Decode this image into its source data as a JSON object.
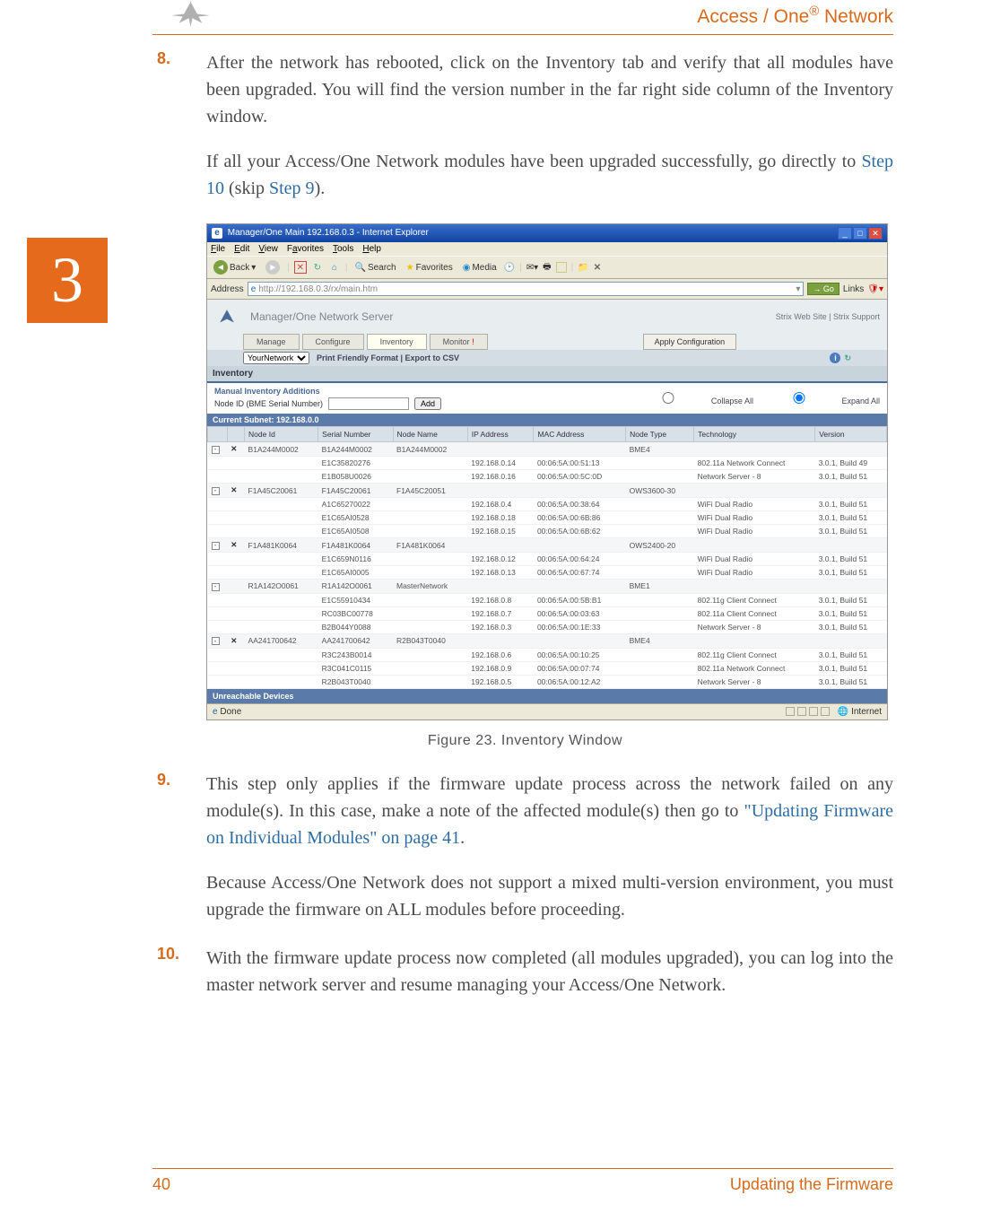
{
  "header": {
    "title_pre": "Access / One",
    "title_sup": "®",
    "title_post": " Network"
  },
  "chapter": "3",
  "steps": {
    "s8": {
      "num": "8.",
      "p1": "After the network has rebooted, click on the Inventory tab and verify that all modules have been upgraded. You will find the version number in the far right side column of the Inventory window.",
      "p2a": "If all your Access/One Network modules have been upgraded successfully, go directly to ",
      "p2link1": "Step 10",
      "p2b": " (skip ",
      "p2link2": "Step 9",
      "p2c": ")."
    },
    "caption": "Figure 23. Inventory Window",
    "s9": {
      "num": "9.",
      "p1a": "This step only applies if the firmware update process across the network failed on any module(s). In this case, make a note of the affected module(s) then go to ",
      "p1link": "\"Updating Firmware on Individual Modules\" on page 41",
      "p1b": ".",
      "p2": "Because Access/One Network does not support a mixed multi-version environment, you must upgrade the firmware on ALL modules before proceeding."
    },
    "s10": {
      "num": "10.",
      "p1": "With the firmware update process now completed (all modules upgraded), you can log into the master network server and resume managing your Access/One Network."
    }
  },
  "footer": {
    "page": "40",
    "section": "Updating the Firmware"
  },
  "screenshot": {
    "winTitle": "Manager/One Main 192.168.0.3 - Internet Explorer",
    "menus": {
      "file": "File",
      "edit": "Edit",
      "view": "View",
      "fav": "Favorites",
      "tools": "Tools",
      "help": "Help"
    },
    "toolbar": {
      "back": "Back",
      "search": "Search",
      "favorites": "Favorites",
      "media": "Media"
    },
    "addressLabel": "Address",
    "addressValue": "http://192.168.0.3/rx/main.htm",
    "go": "Go",
    "links": "Links",
    "serverTitle": "Manager/One Network Server",
    "strixLinks": "Strix Web Site  |  Strix Support",
    "tabs": {
      "manage": "Manage",
      "configure": "Configure",
      "inventory": "Inventory",
      "monitor": "Monitor"
    },
    "applyBtn": "Apply Configuration",
    "subbar": "Print Friendly Format |  Export to CSV",
    "invTitle": "Inventory",
    "addTitle": "Manual Inventory Additions",
    "addLabel": "Node ID (BME Serial Number)",
    "addBtn": "Add",
    "collapse": "Collapse All",
    "expand": "Expand All",
    "subnet": "Current Subnet: 192.168.0.0",
    "headers": [
      "",
      "",
      "Node Id",
      "Serial Number",
      "Node Name",
      "IP Address",
      "MAC Address",
      "Node Type",
      "Technology",
      "Version"
    ],
    "rows": [
      {
        "g": true,
        "exp": "-",
        "x": "✕",
        "nid": "B1A244M0002",
        "sn": "B1A244M0002",
        "nn": "B1A244M0002",
        "ip": "",
        "mac": "",
        "nt": "BME4",
        "tech": "",
        "ver": ""
      },
      {
        "nid": "",
        "sn": "E1C35820276",
        "nn": "",
        "ip": "192.168.0.14",
        "mac": "00:06:5A:00:51:13",
        "nt": "",
        "tech": "802.11a Network Connect",
        "ver": "3.0.1, Build 49"
      },
      {
        "nid": "",
        "sn": "E1B058U0026",
        "nn": "",
        "ip": "192.168.0.16",
        "mac": "00:06:5A:00:5C:0D",
        "nt": "",
        "tech": "Network Server - 8",
        "ver": "3.0.1, Build 51"
      },
      {
        "g": true,
        "exp": "-",
        "x": "✕",
        "nid": "F1A45C20061",
        "sn": "F1A45C20061",
        "nn": "F1A45C20051",
        "ip": "",
        "mac": "",
        "nt": "OWS3600-30",
        "tech": "",
        "ver": ""
      },
      {
        "nid": "",
        "sn": "A1C65270022",
        "nn": "",
        "ip": "192.168.0.4",
        "mac": "00:06:5A:00:38:64",
        "nt": "",
        "tech": "WiFi Dual Radio",
        "ver": "3.0.1, Build 51"
      },
      {
        "nid": "",
        "sn": "E1C65AI0528",
        "nn": "",
        "ip": "192.168.0.18",
        "mac": "00:06:5A:00:6B:86",
        "nt": "",
        "tech": "WiFi Dual Radio",
        "ver": "3.0.1, Build 51"
      },
      {
        "nid": "",
        "sn": "E1C65AI0508",
        "nn": "",
        "ip": "192.168.0.15",
        "mac": "00:06:5A:00:6B:62",
        "nt": "",
        "tech": "WiFi Dual Radio",
        "ver": "3.0.1, Build 51"
      },
      {
        "g": true,
        "exp": "-",
        "x": "✕",
        "nid": "F1A481K0064",
        "sn": "F1A481K0064",
        "nn": "F1A481K0064",
        "ip": "",
        "mac": "",
        "nt": "OWS2400-20",
        "tech": "",
        "ver": ""
      },
      {
        "nid": "",
        "sn": "E1C659N0116",
        "nn": "",
        "ip": "192.168.0.12",
        "mac": "00:06:5A:00:64:24",
        "nt": "",
        "tech": "WiFi Dual Radio",
        "ver": "3.0.1, Build 51"
      },
      {
        "nid": "",
        "sn": "E1C65AI0005",
        "nn": "",
        "ip": "192.168.0.13",
        "mac": "00:06:5A:00:67:74",
        "nt": "",
        "tech": "WiFi Dual Radio",
        "ver": "3.0.1, Build 51"
      },
      {
        "g": true,
        "exp": "-",
        "x": "",
        "nid": "R1A142O0061",
        "sn": "R1A142O0061",
        "nn": "MasterNetwork",
        "ip": "",
        "mac": "",
        "nt": "BME1",
        "tech": "",
        "ver": ""
      },
      {
        "nid": "",
        "sn": "E1C55910434",
        "nn": "",
        "ip": "192.168.0.8",
        "mac": "00:06:5A:00:5B:B1",
        "nt": "",
        "tech": "802.11g Client Connect",
        "ver": "3.0.1, Build 51"
      },
      {
        "nid": "",
        "sn": "RC03BC00778",
        "nn": "",
        "ip": "192.168.0.7",
        "mac": "00:06:5A:00:03:63",
        "nt": "",
        "tech": "802.11a Client Connect",
        "ver": "3.0.1, Build 51"
      },
      {
        "nid": "",
        "sn": "B2B044Y0088",
        "nn": "",
        "ip": "192.168.0.3",
        "mac": "00:06:5A:00:1E:33",
        "nt": "",
        "tech": "Network Server - 8",
        "ver": "3.0.1, Build 51"
      },
      {
        "g": true,
        "exp": "-",
        "x": "✕",
        "nid": "AA241700642",
        "sn": "AA241700642",
        "nn": "R2B043T0040",
        "ip": "",
        "mac": "",
        "nt": "BME4",
        "tech": "",
        "ver": ""
      },
      {
        "nid": "",
        "sn": "R3C243B0014",
        "nn": "",
        "ip": "192.168.0.6",
        "mac": "00:06:5A:00:10:25",
        "nt": "",
        "tech": "802.11g Client Connect",
        "ver": "3.0.1, Build 51"
      },
      {
        "nid": "",
        "sn": "R3C041C0115",
        "nn": "",
        "ip": "192.168.0.9",
        "mac": "00:06:5A:00:07:74",
        "nt": "",
        "tech": "802.11a Network Connect",
        "ver": "3.0.1, Build 51"
      },
      {
        "nid": "",
        "sn": "R2B043T0040",
        "nn": "",
        "ip": "192.168.0.5",
        "mac": "00:06:5A:00:12:A2",
        "nt": "",
        "tech": "Network Server - 8",
        "ver": "3.0.1, Build 51"
      }
    ],
    "unreach": "Unreachable Devices",
    "status": {
      "done": "Done",
      "zone": "Internet"
    }
  }
}
